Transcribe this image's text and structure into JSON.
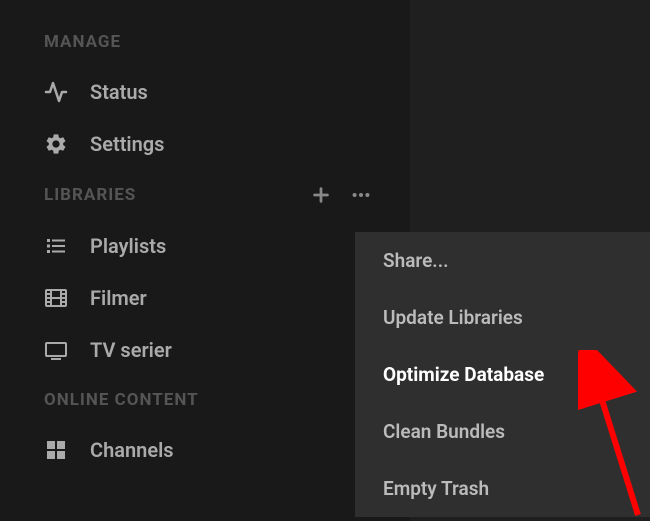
{
  "sections": {
    "manage": {
      "heading": "MANAGE",
      "items": [
        {
          "label": "Status"
        },
        {
          "label": "Settings"
        }
      ]
    },
    "libraries": {
      "heading": "LIBRARIES",
      "items": [
        {
          "label": "Playlists"
        },
        {
          "label": "Filmer"
        },
        {
          "label": "TV serier"
        }
      ]
    },
    "online": {
      "heading": "ONLINE CONTENT",
      "items": [
        {
          "label": "Channels"
        }
      ]
    }
  },
  "context_menu": {
    "items": [
      {
        "label": "Share..."
      },
      {
        "label": "Update Libraries"
      },
      {
        "label": "Optimize Database"
      },
      {
        "label": "Clean Bundles"
      },
      {
        "label": "Empty Trash"
      }
    ]
  }
}
